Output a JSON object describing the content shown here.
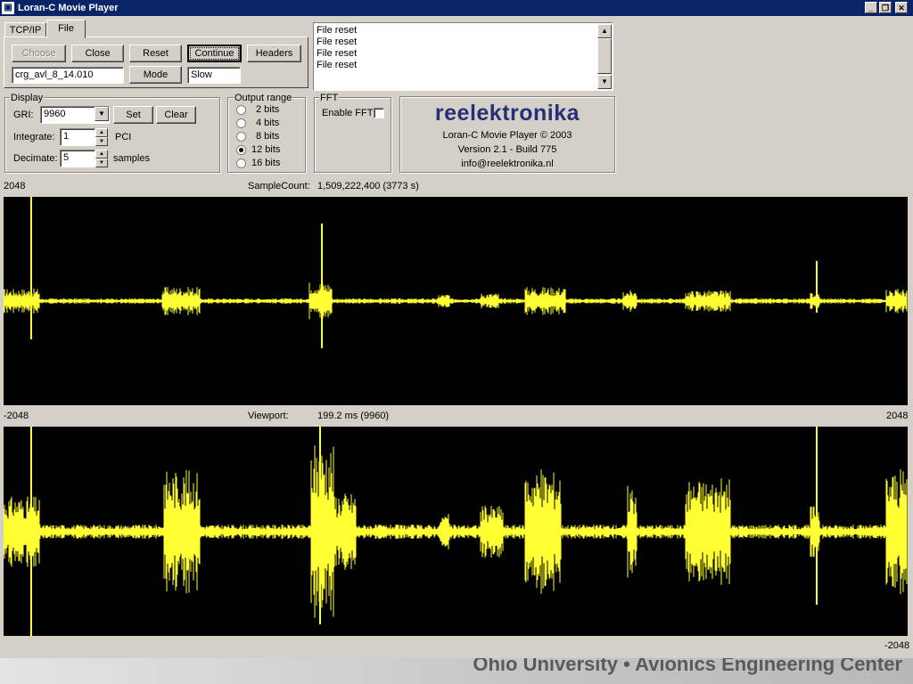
{
  "window": {
    "title": "Loran-C Movie Player",
    "buttons": {
      "minimize": "_",
      "restore": "❐",
      "close": "✕"
    }
  },
  "tabs": [
    {
      "label": "TCP/IP"
    },
    {
      "label": "File",
      "selected": true
    }
  ],
  "file_panel": {
    "choose_label": "Choose",
    "close_label": "Close",
    "reset_label": "Reset",
    "continue_label": "Continue",
    "headers_label": "Headers",
    "filename_value": "crg_avl_8_14.010",
    "mode_label": "Mode",
    "mode_value": "Slow"
  },
  "log": {
    "lines": [
      "File reset",
      "File reset",
      "File reset",
      "File reset"
    ]
  },
  "display": {
    "group_label": "Display",
    "gri_label": "GRI:",
    "gri_value": "9960",
    "set_label": "Set",
    "clear_label": "Clear",
    "integrate_label": "Integrate:",
    "integrate_value": "1",
    "integrate_unit": "PCI",
    "decimate_label": "Decimate:",
    "decimate_value": "5",
    "decimate_unit": "samples"
  },
  "output_range": {
    "group_label": "Output range",
    "options": [
      "2 bits",
      "4 bits",
      "8 bits",
      "12 bits",
      "16 bits"
    ],
    "selected": "12 bits"
  },
  "fft": {
    "group_label": "FFT",
    "enable_label": "Enable FFT",
    "enabled": false
  },
  "about": {
    "brand": "reelektronika",
    "product": "Loran-C Movie Player © 2003",
    "version": "Version 2.1 - Build 775",
    "email": "info@reelektronika.nl"
  },
  "scope_top": {
    "y_max_label": "2048",
    "y_min_label": "-2048",
    "info_key": "SampleCount:",
    "info_value": "1,509,222,400 (3773 s)"
  },
  "scope_bottom": {
    "info_key": "Viewport:",
    "info_value": "199.2 ms (9960)",
    "y_max_label": "2048",
    "y_min_label": "-2048"
  },
  "colors": {
    "trace": "#ffff33",
    "scope_bg": "#000000",
    "titlebar": "#0a246a",
    "brand": "#25307a"
  },
  "footer": {
    "text": "Ohio University • Avionics Engineering Center"
  }
}
